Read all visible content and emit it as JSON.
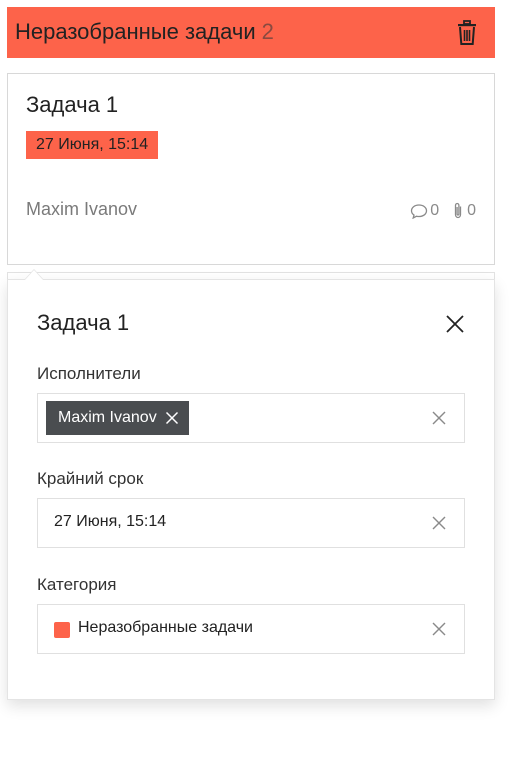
{
  "column": {
    "title": "Неразобранные задачи",
    "count": "2",
    "color": "#fd634a"
  },
  "card": {
    "title": "Задача 1",
    "due": "27 Июня, 15:14",
    "assignee": "Maxim Ivanov",
    "comments": "0",
    "attachments": "0"
  },
  "popup": {
    "title": "Задача 1",
    "assignees_label": "Исполнители",
    "assignee_chip": "Maxim Ivanov",
    "deadline_label": "Крайний срок",
    "deadline_value": "27 Июня, 15:14",
    "category_label": "Категория",
    "category_value": "Неразобранные задачи",
    "category_color": "#fd634a"
  }
}
